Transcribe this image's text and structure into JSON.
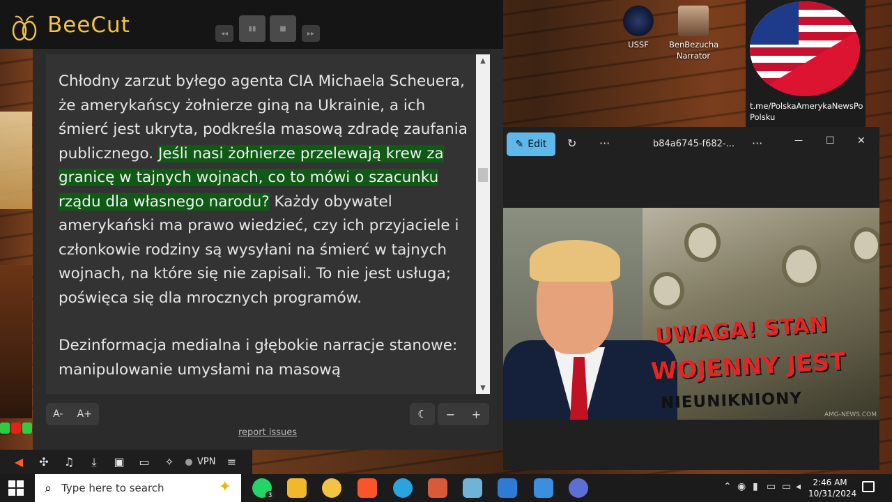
{
  "beecut": {
    "title": "BeeCut",
    "media": {
      "rewind": "◂◂",
      "pause": "▮▮",
      "stop": "■",
      "forward": "▸▸"
    }
  },
  "reader": {
    "paragraph1_part1": "Chłodny zarzut byłego agenta CIA Michaela Scheuera, że amerykańscy żołnierze giną na Ukrainie, a ich śmierć jest ukryta, podkreśla masową zdradę zaufania publicznego.",
    "paragraph1_highlight": "Jeśli nasi żołnierze przelewają krew za granicę w tajnych wojnach, co to mówi o szacunku rządu dla własnego narodu?",
    "paragraph1_part2": "Każdy obywatel amerykański ma prawo wiedzieć, czy ich przyjaciele i członkowie rodziny są wysyłani na śmierć w tajnych wojnach, na które się nie zapisali. To nie jest usługa; poświęca się dla mrocznych programów.",
    "paragraph2": "Dezinformacja medialna i głębokie narracje stanowe: manipulowanie umysłami na masową",
    "font_decrease": "A-",
    "font_increase": "A+",
    "theme_icon": "☾",
    "zoom_out": "−",
    "zoom_in": "+",
    "report_link": "report issues",
    "highlight_color": "#0f5a14"
  },
  "browser_toolbar": {
    "vpn_label": "VPN",
    "icons": [
      "megaphone-icon",
      "puzzle-icon",
      "music-icon",
      "download-icon",
      "sidebar-icon",
      "wallet-icon",
      "leo-icon",
      "menu-icon"
    ]
  },
  "desktop_icons": [
    {
      "label": "USSF"
    },
    {
      "label": "BenBezucha Narrator"
    }
  ],
  "flag_card": {
    "link": "t.me/PolskaAmerykaNewsPo Polsku"
  },
  "photos": {
    "edit_label": "Edit",
    "more1": "···",
    "file_name": "b84a6745-f682-...",
    "more2": "···",
    "minimize": "—",
    "maximize": "☐",
    "close": "✕",
    "overlay_line1": "UWAGA! STAN",
    "overlay_line2": "WOJENNY JEST",
    "overlay_line3": "NIEUNIKNIONY",
    "watermark": "AMG-NEWS.COM"
  },
  "taskbar": {
    "search_placeholder": "Type here to search",
    "whatsapp_badge": "3",
    "time": "2:46 AM",
    "date": "10/31/2024"
  }
}
